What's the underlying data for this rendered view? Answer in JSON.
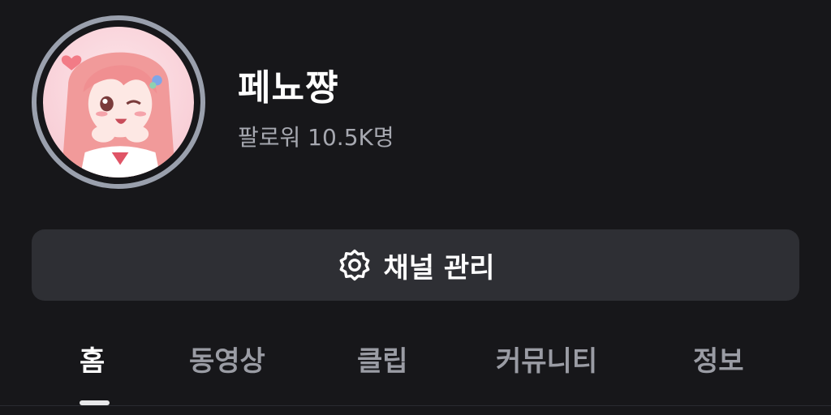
{
  "profile": {
    "channel_name": "페뇨쨩",
    "followers": "팔로워 10.5K명"
  },
  "manage_button": {
    "label": "채널 관리",
    "icon": "gear-icon"
  },
  "tabs": [
    {
      "label": "홈",
      "active": true
    },
    {
      "label": "동영상",
      "active": false
    },
    {
      "label": "클립",
      "active": false
    },
    {
      "label": "커뮤니티",
      "active": false
    },
    {
      "label": "정보",
      "active": false
    }
  ],
  "colors": {
    "background": "#17171a",
    "button_bg": "#2e2f34",
    "avatar_ring": "#9aa0ad",
    "muted_text": "#a6a8b0"
  }
}
